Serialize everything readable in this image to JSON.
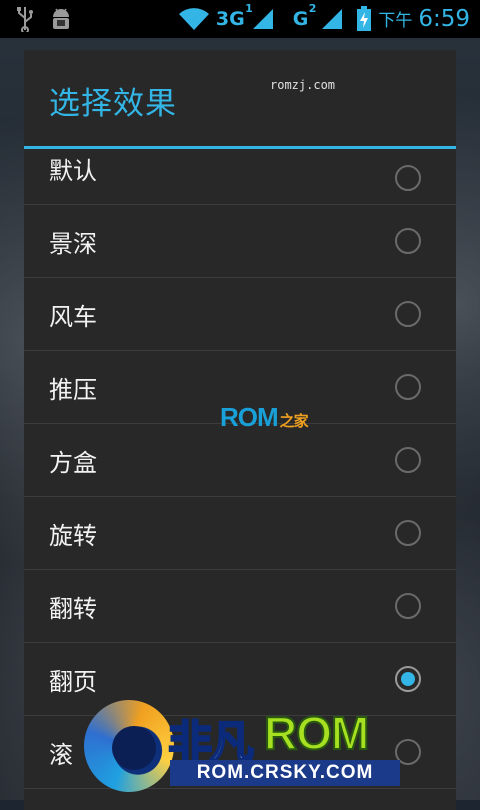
{
  "statusbar": {
    "network1": "3G",
    "network1_sim": "1",
    "network2": "G",
    "network2_sim": "2",
    "ampm": "下午",
    "time": "6:59"
  },
  "dialog": {
    "title": "选择效果",
    "watermark": "romzj.com",
    "options": [
      {
        "label": "默认",
        "checked": false
      },
      {
        "label": "景深",
        "checked": false
      },
      {
        "label": "风车",
        "checked": false
      },
      {
        "label": "推压",
        "checked": false
      },
      {
        "label": "方盒",
        "checked": false
      },
      {
        "label": "旋转",
        "checked": false
      },
      {
        "label": "翻转",
        "checked": false
      },
      {
        "label": "翻页",
        "checked": true
      },
      {
        "label": "滚",
        "checked": false
      }
    ]
  },
  "watermarks": {
    "center_rom": "ROM",
    "center_suffix": "之家",
    "brand_cn": "非凡",
    "brand_rom": "ROM",
    "brand_url": "ROM.CRSKY.COM"
  },
  "colors": {
    "accent": "#33b5e5",
    "dialog_bg": "#282828"
  }
}
